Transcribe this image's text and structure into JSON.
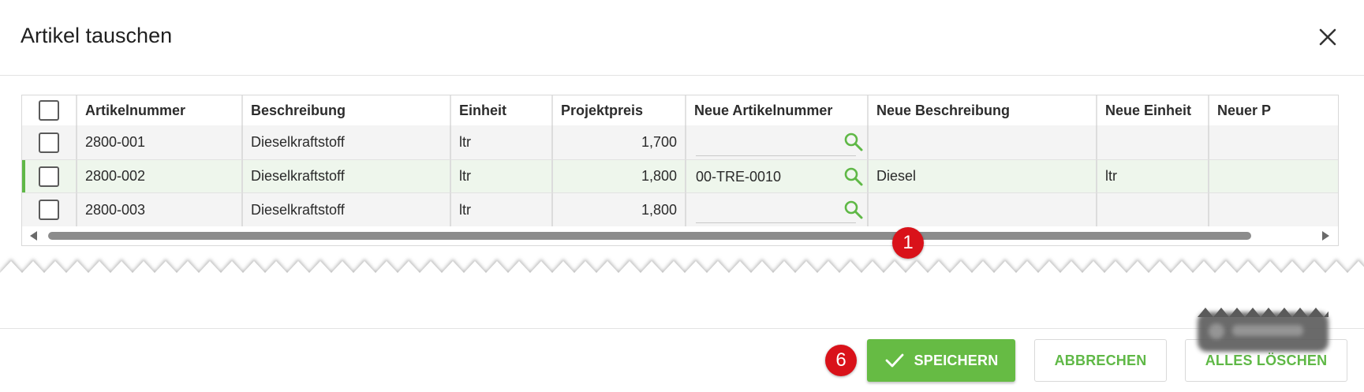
{
  "dialog": {
    "title": "Artikel tauschen",
    "close_icon": "close-icon"
  },
  "grid": {
    "columns": [
      "Artikelnummer",
      "Beschreibung",
      "Einheit",
      "Projektpreis",
      "Neue Artikelnummer",
      "Neue Beschreibung",
      "Neue Einheit",
      "Neuer P"
    ],
    "rows": [
      {
        "artikelnummer": "2800-001",
        "beschreibung": "Dieselkraftstoff",
        "einheit": "ltr",
        "projektpreis": "1,700",
        "neue_artikelnummer": "",
        "neue_beschreibung": "",
        "neue_einheit": "",
        "selected": false
      },
      {
        "artikelnummer": "2800-002",
        "beschreibung": "Dieselkraftstoff",
        "einheit": "ltr",
        "projektpreis": "1,800",
        "neue_artikelnummer": "00-TRE-0010",
        "neue_beschreibung": "Diesel",
        "neue_einheit": "ltr",
        "selected": true
      },
      {
        "artikelnummer": "2800-003",
        "beschreibung": "Dieselkraftstoff",
        "einheit": "ltr",
        "projektpreis": "1,800",
        "neue_artikelnummer": "",
        "neue_beschreibung": "",
        "neue_einheit": "",
        "selected": false
      }
    ],
    "lookup_icon": "search-icon"
  },
  "annotations": {
    "badge_scroll": "1",
    "badge_save": "6"
  },
  "footer": {
    "save_label": "SPEICHERN",
    "cancel_label": "ABBRECHEN",
    "clear_label": "ALLES LÖSCHEN"
  },
  "colors": {
    "accent": "#66bb44",
    "badge": "#d9121a",
    "selected_row": "#eef6ec"
  }
}
